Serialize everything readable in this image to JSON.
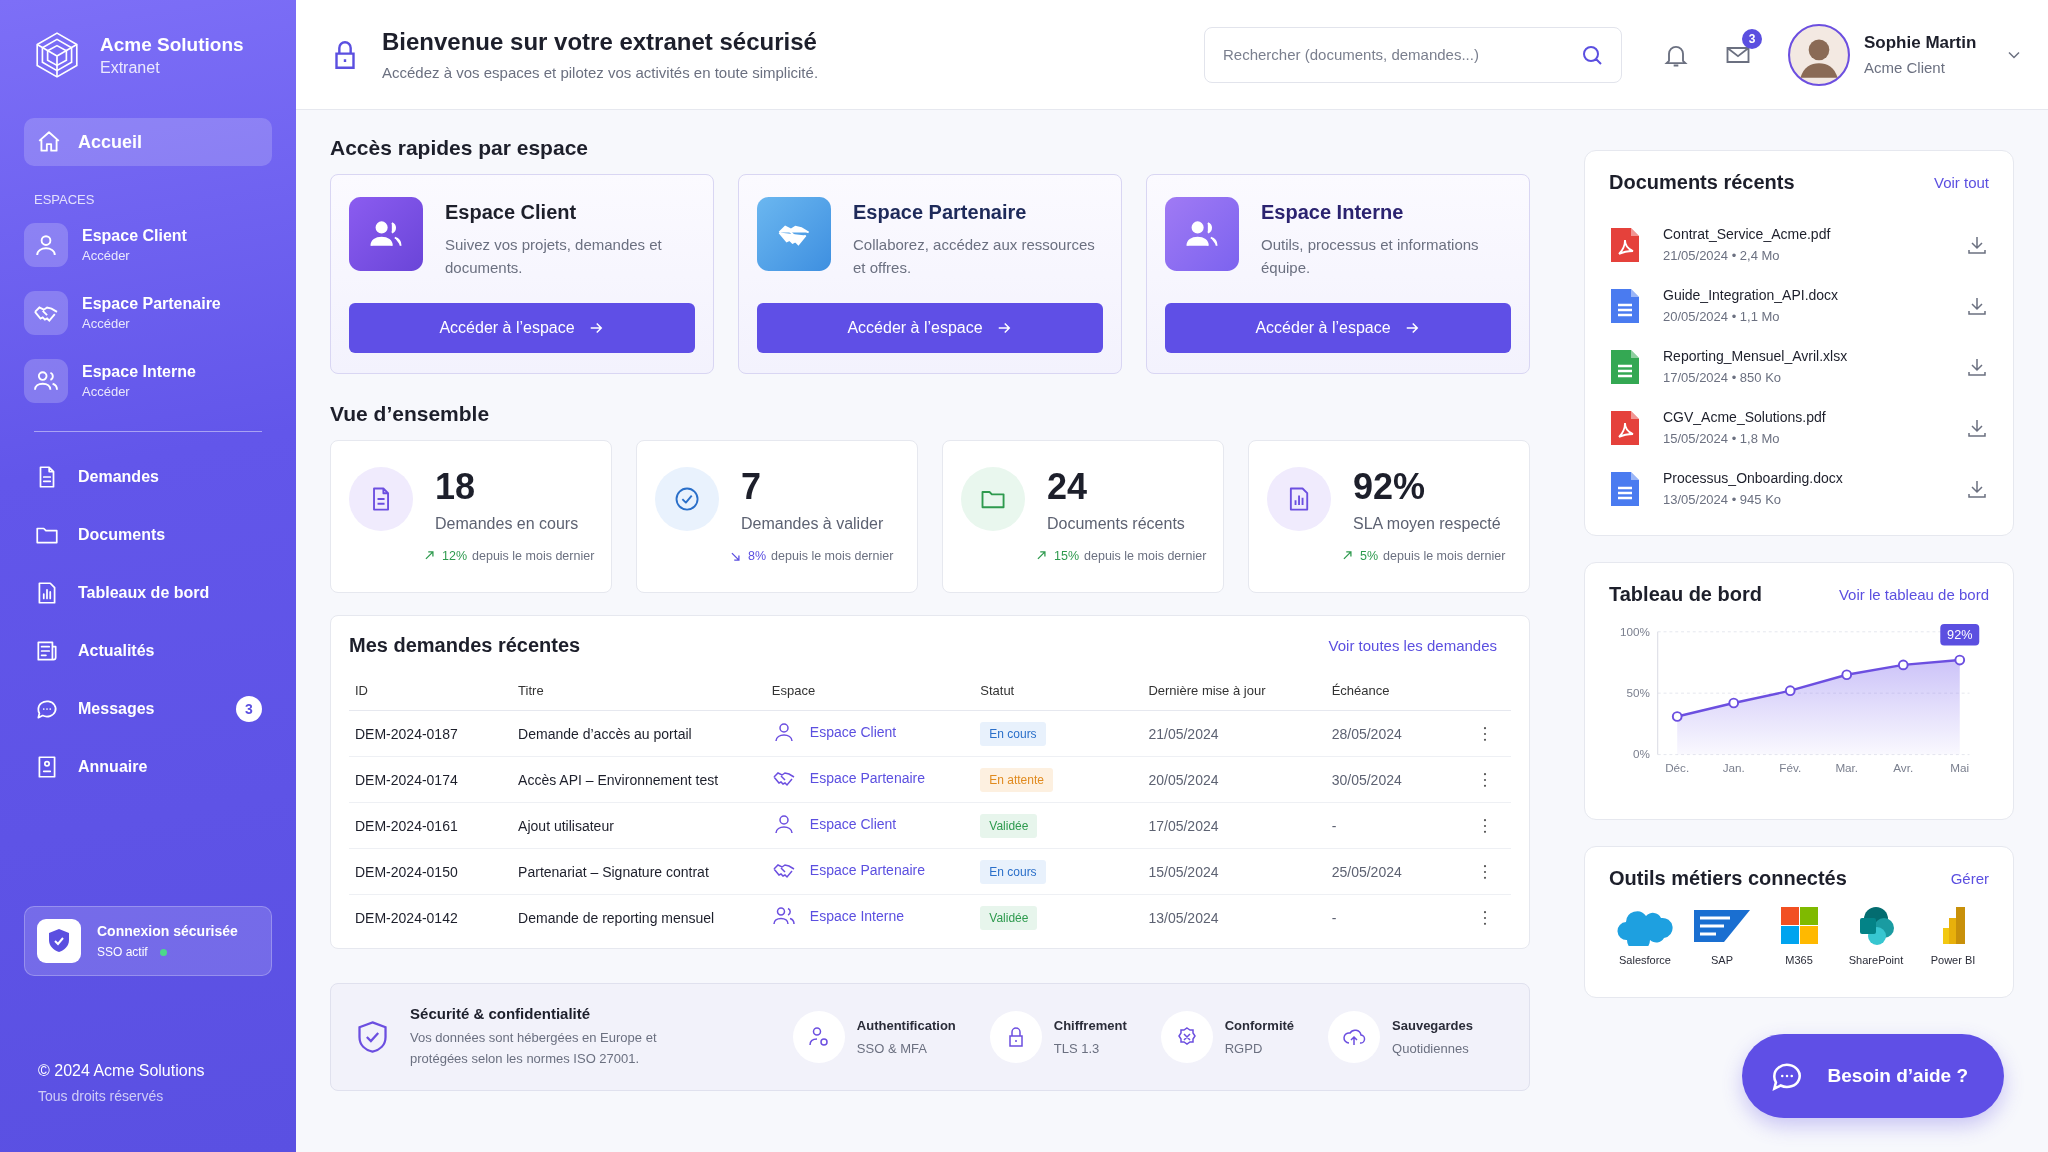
{
  "sidebar": {
    "brand": {
      "name": "Acme Solutions",
      "subtitle": "Extranet"
    },
    "home": {
      "label": "Accueil",
      "selected": true
    },
    "section_label": "ESPACES",
    "spaces": [
      {
        "name": "Espace Client",
        "action": "Accéder"
      },
      {
        "name": "Espace Partenaire",
        "action": "Accéder"
      },
      {
        "name": "Espace Interne",
        "action": "Accéder"
      }
    ],
    "nav": [
      {
        "label": "Demandes",
        "selected": false
      },
      {
        "label": "Documents",
        "selected": false
      },
      {
        "label": "Tableaux de bord",
        "selected": false
      },
      {
        "label": "Actualités",
        "selected": false
      },
      {
        "label": "Messages",
        "selected": false,
        "badge": "3"
      },
      {
        "label": "Annuaire",
        "selected": false
      }
    ],
    "secure": {
      "title": "Connexion sécurisée",
      "status": "SSO actif",
      "active": true
    },
    "footer": {
      "copyright": "© 2024 Acme Solutions",
      "rights": "Tous droits réservés"
    }
  },
  "header": {
    "title": "Bienvenue sur votre extranet sécurisé",
    "subtitle": "Accédez à vos espaces et pilotez vos activités en toute simplicité.",
    "search": {
      "placeholder": "Rechercher (documents, demandes...)"
    },
    "messages_badge": "3",
    "user": {
      "name": "Sophie Martin",
      "org": "Acme Client"
    }
  },
  "quick_access": {
    "title": "Accès rapides par espace",
    "cards": [
      {
        "title": "Espace Client",
        "description": "Suivez vos projets, demandes et documents.",
        "button": "Accéder à l’espace"
      },
      {
        "title": "Espace Partenaire",
        "description": "Collaborez, accédez aux ressources et offres.",
        "button": "Accéder à l’espace"
      },
      {
        "title": "Espace Interne",
        "description": "Outils, processus et informations équipe.",
        "button": "Accéder à l’espace"
      }
    ]
  },
  "overview": {
    "title": "Vue d’ensemble",
    "stats": [
      {
        "value": "18",
        "label": "Demandes en cours",
        "change": "12%",
        "period": "depuis le mois dernier",
        "kind": "up"
      },
      {
        "value": "7",
        "label": "Demandes à valider",
        "change": "8%",
        "period": "depuis le mois dernier",
        "kind": "down"
      },
      {
        "value": "24",
        "label": "Documents récents",
        "change": "15%",
        "period": "depuis le mois dernier",
        "kind": "up"
      },
      {
        "value": "92%",
        "label": "SLA moyen respecté",
        "change": "5%",
        "period": "depuis le mois dernier",
        "kind": "up"
      }
    ]
  },
  "requests": {
    "title": "Mes demandes récentes",
    "link": "Voir toutes les demandes",
    "columns": [
      "ID",
      "Titre",
      "Espace",
      "Statut",
      "Dernière mise à jour",
      "Échéance"
    ],
    "rows": [
      {
        "id": "DEM-2024-0187",
        "title": "Demande d’accès au portail",
        "space": {
          "name": "Espace Client",
          "kind": "client"
        },
        "status": {
          "label": "En cours",
          "kind": "progress"
        },
        "updated": "21/05/2024",
        "due": "28/05/2024"
      },
      {
        "id": "DEM-2024-0174",
        "title": "Accès API – Environnement test",
        "space": {
          "name": "Espace Partenaire",
          "kind": "partner"
        },
        "status": {
          "label": "En attente",
          "kind": "pending"
        },
        "updated": "20/05/2024",
        "due": "30/05/2024"
      },
      {
        "id": "DEM-2024-0161",
        "title": "Ajout utilisateur",
        "space": {
          "name": "Espace Client",
          "kind": "client"
        },
        "status": {
          "label": "Validée",
          "kind": "done"
        },
        "updated": "17/05/2024",
        "due": "-"
      },
      {
        "id": "DEM-2024-0150",
        "title": "Partenariat – Signature contrat",
        "space": {
          "name": "Espace Partenaire",
          "kind": "partner"
        },
        "status": {
          "label": "En cours",
          "kind": "progress"
        },
        "updated": "15/05/2024",
        "due": "25/05/2024"
      },
      {
        "id": "DEM-2024-0142",
        "title": "Demande de reporting mensuel",
        "space": {
          "name": "Espace Interne",
          "kind": "internal"
        },
        "status": {
          "label": "Validée",
          "kind": "done"
        },
        "updated": "13/05/2024",
        "due": "-"
      }
    ]
  },
  "security": {
    "title": "Sécurité & confidentialité",
    "text": "Vos données sont hébergées en Europe et protégées selon les normes ISO 27001.",
    "features": [
      {
        "title": "Authentification",
        "detail": "SSO & MFA"
      },
      {
        "title": "Chiffrement",
        "detail": "TLS 1.3"
      },
      {
        "title": "Conformité",
        "detail": "RGPD"
      },
      {
        "title": "Sauvegardes",
        "detail": "Quotidiennes"
      }
    ]
  },
  "documents": {
    "title": "Documents récents",
    "link": "Voir tout",
    "items": [
      {
        "name": "Contrat_Service_Acme.pdf",
        "meta": "21/05/2024 • 2,4 Mo",
        "kind": "pdf"
      },
      {
        "name": "Guide_Integration_API.docx",
        "meta": "20/05/2024 • 1,1 Mo",
        "kind": "doc"
      },
      {
        "name": "Reporting_Mensuel_Avril.xlsx",
        "meta": "17/05/2024 • 850 Ko",
        "kind": "sheet"
      },
      {
        "name": "CGV_Acme_Solutions.pdf",
        "meta": "15/05/2024 • 1,8 Mo",
        "kind": "pdf"
      },
      {
        "name": "Processus_Onboarding.docx",
        "meta": "13/05/2024 • 945 Ko",
        "kind": "doc"
      }
    ]
  },
  "dashboard": {
    "title": "Tableau de bord",
    "link": "Voir le tableau de bord",
    "chart_data": {
      "type": "area",
      "categories": [
        "Déc.",
        "Jan.",
        "Fév.",
        "Mar.",
        "Avr.",
        "Mai"
      ],
      "series": [
        {
          "color": "#6c4fe0",
          "values": [
            31,
            42,
            52,
            65,
            73,
            77
          ]
        }
      ],
      "ylim": [
        0,
        100
      ],
      "yticks": [
        {
          "value": 0,
          "label": "0%"
        },
        {
          "value": 50,
          "label": "50%"
        },
        {
          "value": 100,
          "label": "100%"
        }
      ],
      "annotations": [
        {
          "text": "92%",
          "x": "Mai"
        }
      ]
    }
  },
  "tools": {
    "title": "Outils métiers connectés",
    "link": "Gérer",
    "items": [
      {
        "name": "Salesforce"
      },
      {
        "name": "SAP"
      },
      {
        "name": "M365"
      },
      {
        "name": "SharePoint"
      },
      {
        "name": "Power BI"
      }
    ]
  },
  "help_button": {
    "label": "Besoin d’aide ?"
  }
}
